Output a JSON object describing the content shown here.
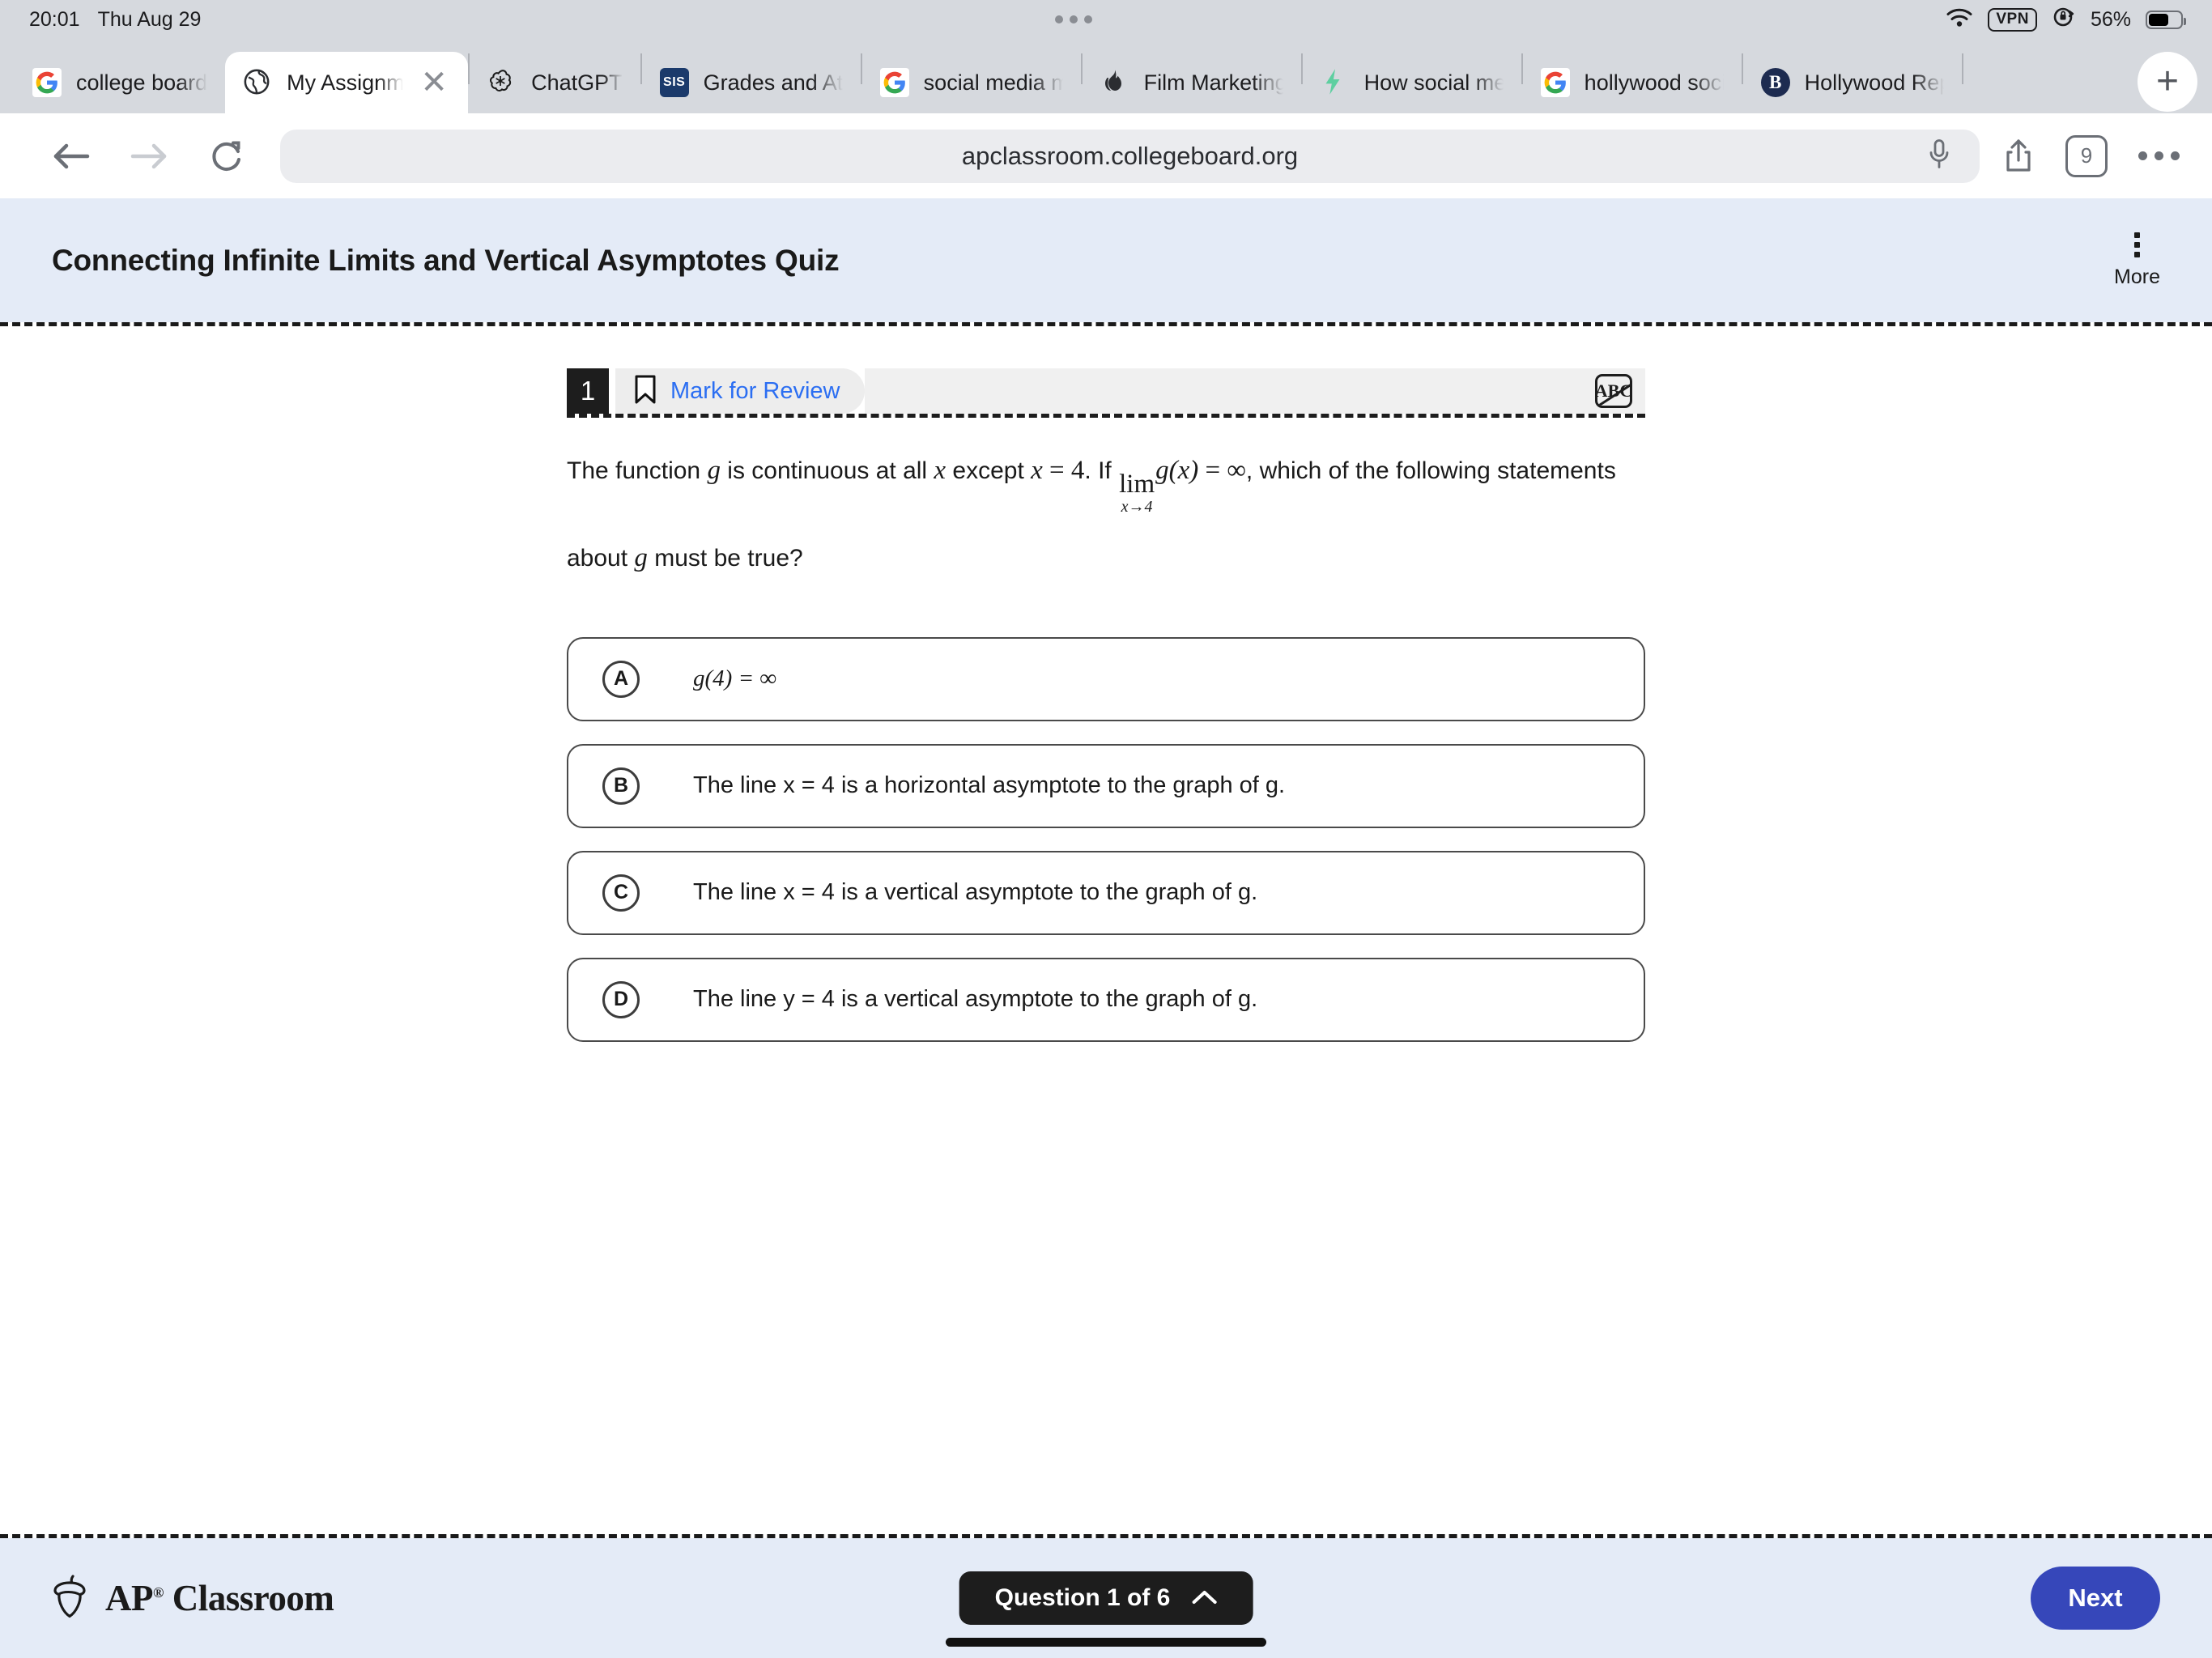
{
  "status_bar": {
    "time": "20:01",
    "date": "Thu Aug 29",
    "vpn": "VPN",
    "battery_percent": "56%"
  },
  "browser": {
    "tabs": [
      {
        "label": "college board",
        "favicon": "google-icon",
        "active": false
      },
      {
        "label": "My Assignments",
        "favicon": "globe-icon",
        "active": true
      },
      {
        "label": "ChatGPT",
        "favicon": "openai-icon",
        "active": false
      },
      {
        "label": "Grades and Attendance",
        "favicon": "sis-icon",
        "active": false
      },
      {
        "label": "social media marketing",
        "favicon": "google-icon",
        "active": false
      },
      {
        "label": "Film Marketing",
        "favicon": "flame-icon",
        "active": false
      },
      {
        "label": "How social media",
        "favicon": "bolt-icon",
        "active": false
      },
      {
        "label": "hollywood social",
        "favicon": "google-icon",
        "active": false
      },
      {
        "label": "Hollywood Reporter",
        "favicon": "b-icon",
        "active": false
      }
    ],
    "new_tab_label": "+",
    "url": "apclassroom.collegeboard.org",
    "tab_count": "9",
    "sis_favicon_text": "SIS",
    "b_favicon_text": "B",
    "g_favicon_text": "G"
  },
  "page_header": {
    "title": "Connecting Infinite Limits and Vertical Asymptotes Quiz",
    "more_label": "More"
  },
  "question": {
    "number": "1",
    "mark_for_review": "Mark for Review",
    "eliminate_tool_label": "ABC",
    "stem_part1": "The function ",
    "stem_g1": "g",
    "stem_part2": " is continuous at all ",
    "stem_x1": "x",
    "stem_part3": " except ",
    "stem_x2": "x",
    "stem_eq": " = ",
    "stem_4": "4",
    "stem_part4": ". If ",
    "lim_top": "lim",
    "lim_bottom": "x→4",
    "lim_expr": "g(x)",
    "lim_eq": " = ",
    "lim_inf": "∞",
    "stem_part5": ", which of the following statements",
    "stem_line2_a": "about ",
    "stem_line2_g": "g",
    "stem_line2_b": " must be true?",
    "choices": [
      {
        "letter": "A",
        "text": "g(4) = ∞",
        "math": true
      },
      {
        "letter": "B",
        "text": "The line x = 4 is a horizontal asymptote to the graph of g."
      },
      {
        "letter": "C",
        "text": "The line x = 4 is a vertical asymptote to the graph of g."
      },
      {
        "letter": "D",
        "text": "The line y = 4 is a vertical asymptote to the graph of g."
      }
    ]
  },
  "footer": {
    "brand": "AP",
    "brand_reg": "®",
    "brand_second": "Classroom",
    "question_counter": "Question 1 of 6",
    "next_label": "Next"
  },
  "colors": {
    "header_bg": "#e4ebf7",
    "accent_blue": "#2b6ef2",
    "next_blue": "#3647ba",
    "chrome_bg": "#d6d9de"
  }
}
